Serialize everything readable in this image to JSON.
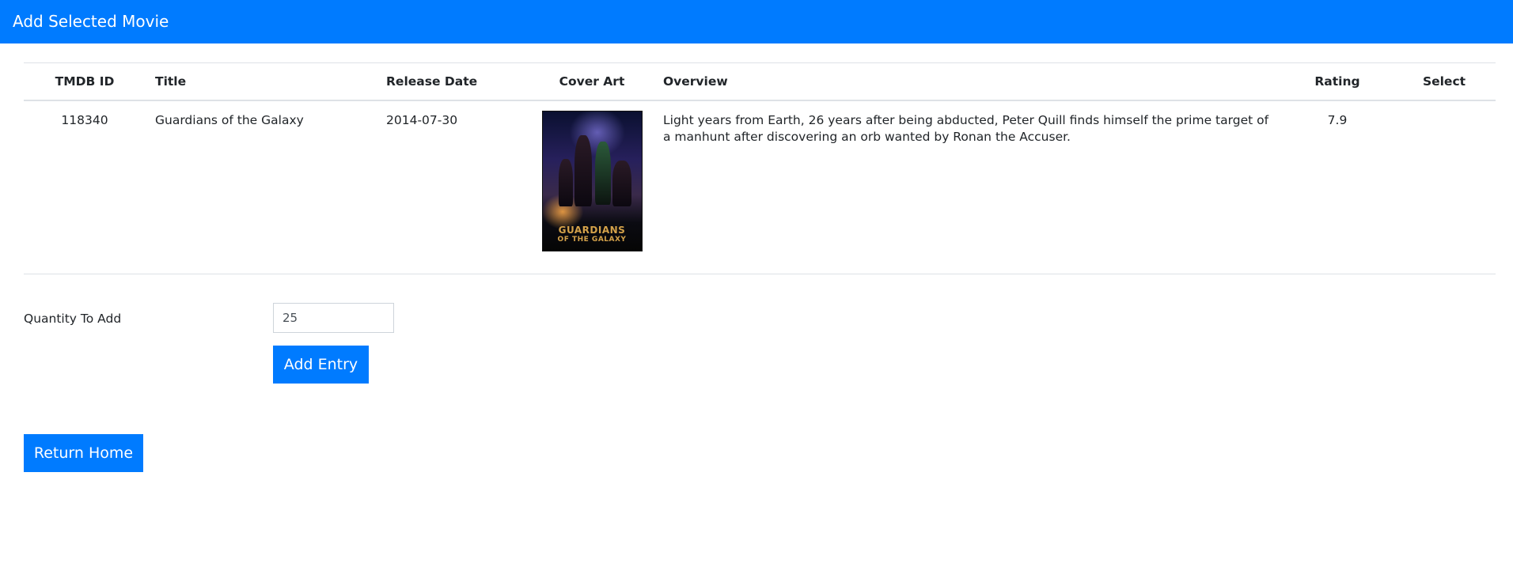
{
  "header": {
    "title": "Add Selected Movie",
    "color": "#007bff"
  },
  "table": {
    "columns": [
      "TMDB ID",
      "Title",
      "Release Date",
      "Cover Art",
      "Overview",
      "Rating",
      "Select"
    ],
    "rows": [
      {
        "tmdb_id": "118340",
        "title": "Guardians of the Galaxy",
        "release_date": "2014-07-30",
        "cover_art": "movie-poster-image",
        "cover_art_logo_line1": "GUARDIANS",
        "cover_art_logo_line2": "OF THE GALAXY",
        "overview": "Light years from Earth, 26 years after being abducted, Peter Quill finds himself the prime target of a manhunt after discovering an orb wanted by Ronan the Accuser.",
        "rating": "7.9",
        "select": ""
      }
    ]
  },
  "form": {
    "quantity_label": "Quantity To Add",
    "quantity_value": "25",
    "add_button_label": "Add Entry"
  },
  "footer": {
    "return_button_label": "Return Home"
  }
}
